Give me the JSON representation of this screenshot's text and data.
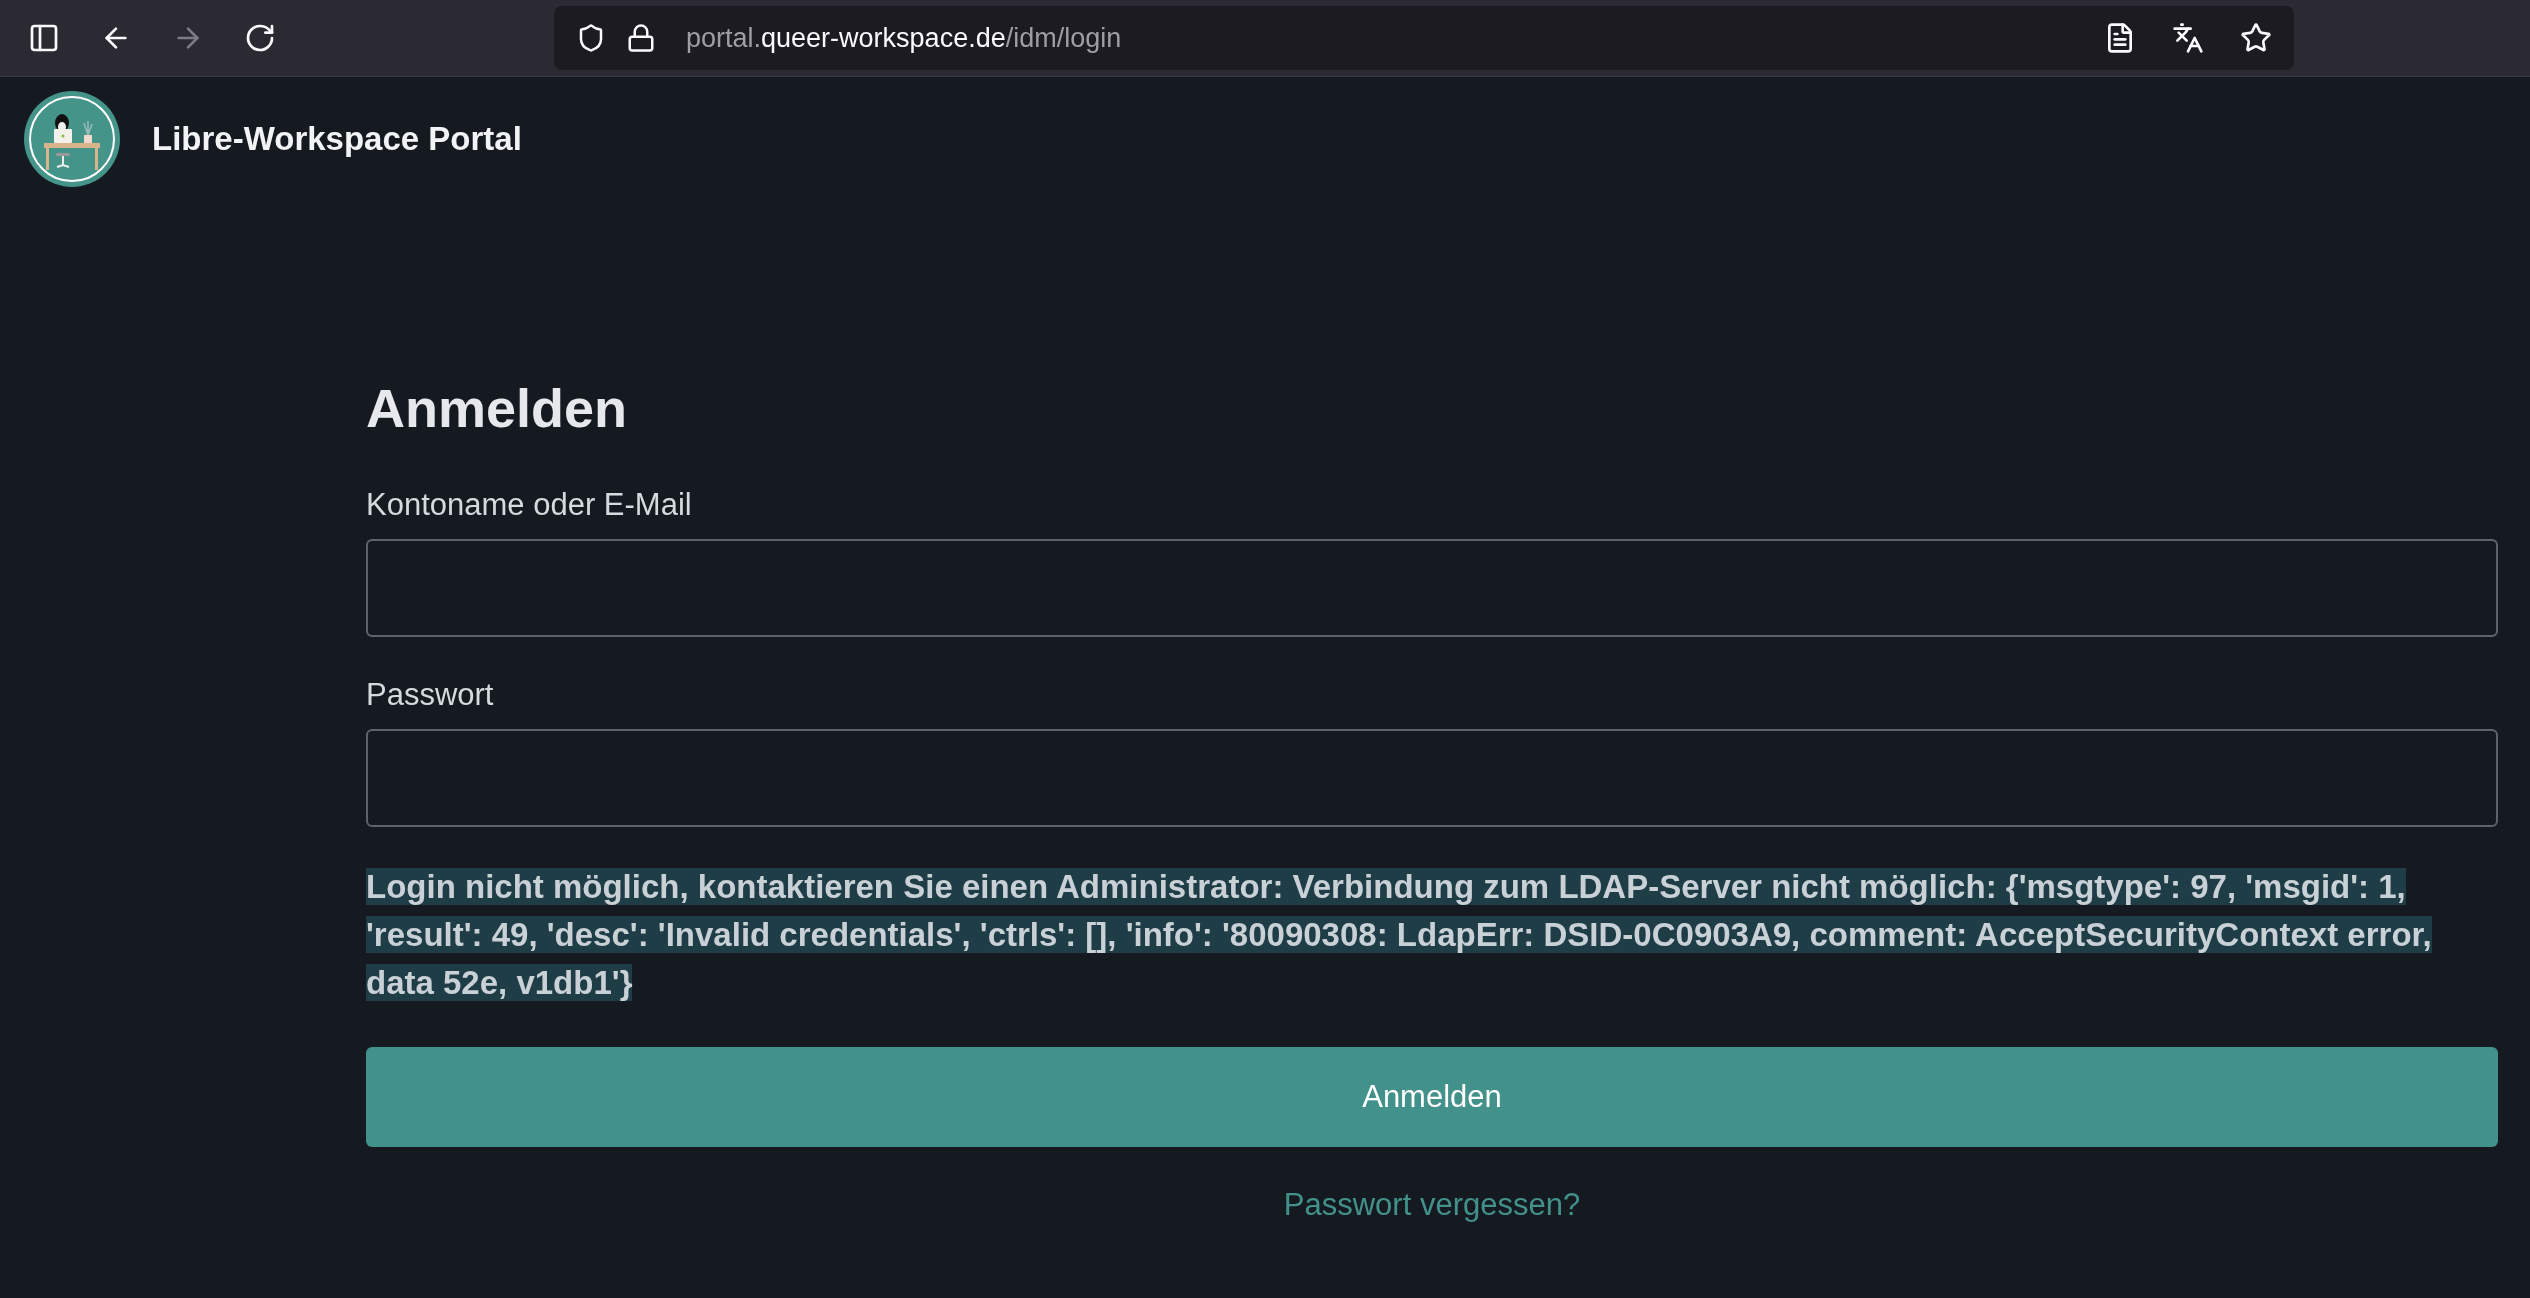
{
  "browser": {
    "nav_buttons": [
      {
        "kind": "sidebar",
        "disabled": false
      },
      {
        "kind": "back",
        "disabled": false
      },
      {
        "kind": "forward",
        "disabled": true
      },
      {
        "kind": "reload",
        "disabled": false
      }
    ],
    "url": {
      "prefix": "portal.",
      "domain": "queer-workspace.de",
      "path": "/idm/login"
    },
    "address_icons": [
      {
        "kind": "reader"
      },
      {
        "kind": "translate"
      },
      {
        "kind": "bookmark"
      }
    ]
  },
  "header": {
    "title": "Libre-Workspace Portal"
  },
  "login": {
    "heading": "Anmelden",
    "fields": [
      {
        "label": "Kontoname oder E-Mail"
      },
      {
        "label": "Passwort"
      }
    ],
    "error": "Login nicht möglich, kontaktieren Sie einen Administrator: Verbindung zum LDAP-Server nicht möglich: {'msgtype': 97, 'msgid': 1, 'result': 49, 'desc': 'Invalid credentials', 'ctrls': [], 'info': '80090308: LdapErr: DSID-0C0903A9, comment: AcceptSecurityContext error, data 52e, v1db1'}",
    "submit": "Anmelden",
    "forgot_link": "Passwort vergessen?"
  }
}
